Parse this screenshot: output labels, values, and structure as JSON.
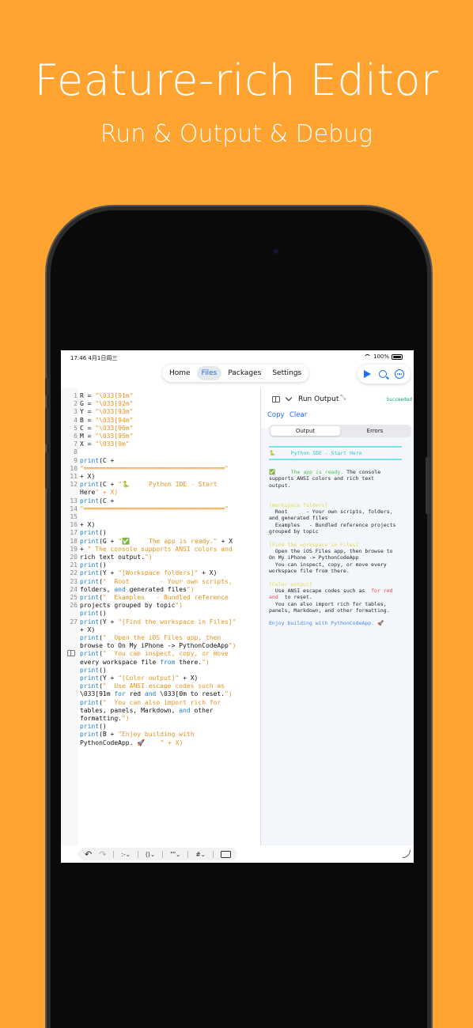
{
  "promo": {
    "headline": "Feature-rich Editor",
    "subheadline": "Run & Output & Debug"
  },
  "status_bar": {
    "time": "17:46",
    "date": "4月1日周三",
    "battery": "100%"
  },
  "toolbar": {
    "tabs": [
      {
        "label": "Home"
      },
      {
        "label": "Files"
      },
      {
        "label": "Packages"
      },
      {
        "label": "Settings"
      }
    ],
    "active_tab": "Files",
    "actions": [
      "play-icon",
      "magnifier-icon",
      "ellipsis-icon"
    ]
  },
  "editor": {
    "lines": [
      {
        "n": "1",
        "code": "R = \"\\033[91m\""
      },
      {
        "n": "2",
        "code": "G = \"\\033[92m\""
      },
      {
        "n": "3",
        "code": "Y = \"\\033[93m\""
      },
      {
        "n": "4",
        "code": "B = \"\\033[94m\""
      },
      {
        "n": "5",
        "code": "C = \"\\033[96m\""
      },
      {
        "n": "6",
        "code": "M = \"\\033[95m\""
      },
      {
        "n": "7",
        "code": "X = \"\\033[0m\""
      },
      {
        "n": "8",
        "code": ""
      },
      {
        "n": "9",
        "code": "print(C +"
      },
      {
        "n": "10",
        "code": "\"═════════════════════════════════════\""
      },
      {
        "n": "11",
        "code": "+ X)"
      },
      {
        "n": "12",
        "code": "print(C + \"🐍     Python IDE - Start"
      },
      {
        "n": "",
        "code": "Here\" + X)"
      },
      {
        "n": "13",
        "code": "print(C +"
      },
      {
        "n": "14",
        "code": "\"═════════════════════════════════════\""
      },
      {
        "n": "15",
        "code": ""
      },
      {
        "n": "16",
        "code": "+ X)"
      },
      {
        "n": "17",
        "code": "print()"
      },
      {
        "n": "18",
        "code": "print(G + \"✅     The app is ready.\" + X"
      },
      {
        "n": "19",
        "code": "+ \" The console supports ANSI colors and"
      },
      {
        "n": "20",
        "code": "rich text output.\")"
      },
      {
        "n": "21",
        "code": "print()"
      },
      {
        "n": "22",
        "code": "print(Y + \"[Workspace folders]\" + X)"
      },
      {
        "n": "23",
        "code": "print(\"  Root        - Your own scripts,"
      },
      {
        "n": "24",
        "code": "folders, and generated files\")"
      },
      {
        "n": "25",
        "code": "print(\"  Examples   - Bundled reference"
      },
      {
        "n": "26",
        "code": "projects grouped by topic\")"
      },
      {
        "n": "",
        "code": "print()"
      },
      {
        "n": "27",
        "code": "print(Y + \"[Find the workspace in Files]\""
      },
      {
        "n": "",
        "code": "+ X)"
      },
      {
        "n": "",
        "code": "print(\"  Open the iOS Files app, then"
      },
      {
        "n": "",
        "code": "browse to On My iPhone -> PythonCodeApp\")"
      },
      {
        "n": "",
        "code": "print(\"  You can inspect, copy, or move"
      },
      {
        "n": "",
        "code": "every workspace file from there.\")"
      },
      {
        "n": "",
        "code": "print()"
      },
      {
        "n": "",
        "code": "print(Y + \"[Color output]\" + X)"
      },
      {
        "n": "",
        "code": "print(\"  Use ANSI escape codes such as"
      },
      {
        "n": "",
        "code": "\\033[91m for red and \\033[0m to reset.\")"
      },
      {
        "n": "",
        "code": "print(\"  You can also import rich for"
      },
      {
        "n": "",
        "code": "tables, panels, Markdown, and other"
      },
      {
        "n": "",
        "code": "formatting.\")"
      },
      {
        "n": "",
        "code": "print()"
      },
      {
        "n": "",
        "code": "print(B + \"Enjoy building with"
      },
      {
        "n": "",
        "code": "PythonCodeApp. 🚀    \" + X)"
      }
    ]
  },
  "run_panel": {
    "title": "Run Output",
    "status": "Succeeded",
    "copy_label": "Copy",
    "clear_label": "Clear",
    "segments": [
      "Output",
      "Errors"
    ],
    "active_segment": "Output",
    "output": {
      "banner": "🐍     Python IDE - Start Here",
      "ready": "✅     The app is ready.",
      "ready_rest": " The console\nsupports ANSI colors and rich text\noutput.",
      "ws_heading": "[Workspace folders]",
      "ws_body": "  Root      - Your own scripts, folders,\nand generated files\n  Examples   - Bundled reference projects\ngrouped by topic",
      "find_heading": "[Find the workspace in Files]",
      "find_body": "  Open the iOS Files app, then browse to\nOn My iPhone -> PythonCodeApp\n  You can inspect, copy, or move every\nworkspace file from there.",
      "color_heading": "[Color output]",
      "color_body_1": "  Use ANSI escape codes such as  ",
      "color_red_1": "for red",
      "color_red_2": "and",
      "color_body_2": "  to reset.\n  You can also import rich for tables,\npanels, Markdown, and other formatting.",
      "enjoy": "Enjoy building with PythonCodeApp. 🚀"
    }
  },
  "bottom_bar": {
    "items": [
      ":-",
      "()",
      "\"\"",
      "#"
    ]
  },
  "colors": {
    "background": "#FFA331",
    "accent": "#1b6ff0",
    "succeeded": "#1a9c7c"
  }
}
